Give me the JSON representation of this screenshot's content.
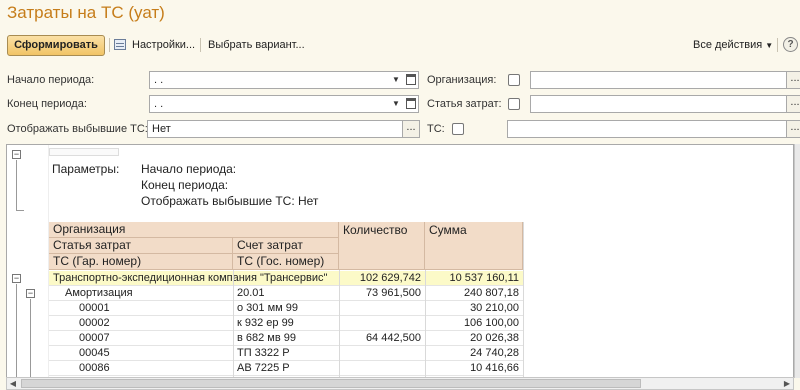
{
  "window": {
    "title": "Затраты на ТС (уат)"
  },
  "toolbar": {
    "generate_label": "Сформировать",
    "settings_label": "Настройки...",
    "choose_variant_label": "Выбрать вариант...",
    "all_actions_label": "Все действия",
    "help_label": "?"
  },
  "filters": {
    "period_start": {
      "label": "Начало периода:",
      "value": " .  ."
    },
    "period_end": {
      "label": "Конец периода:",
      "value": " .  ."
    },
    "show_retired": {
      "label": "Отображать выбывшие ТС:",
      "value": "Нет"
    },
    "organization": {
      "label": "Организация:",
      "checked": false,
      "value": ""
    },
    "cost_item": {
      "label": "Статья затрат:",
      "checked": false,
      "value": ""
    },
    "vehicle": {
      "label": "ТС:",
      "checked": false,
      "value": ""
    }
  },
  "report": {
    "params_label": "Параметры:",
    "params": [
      "Начало периода:",
      "Конец периода:",
      "Отображать выбывшие ТС: Нет"
    ],
    "headers": {
      "organization": "Организация",
      "cost_item": "Статья затрат",
      "account": "Счет затрат",
      "vehicle_garage": "ТС (Гар. номер)",
      "vehicle_state": "ТС (Гос. номер)",
      "quantity": "Количество",
      "sum": "Сумма"
    },
    "rows": [
      {
        "level": 0,
        "name": "Транспортно-экспедиционная компания \"Трансервис\"",
        "col2": "",
        "qty": "102 629,742",
        "sum": "10 537 160,11"
      },
      {
        "level": 1,
        "name": "Амортизация",
        "col2": "20.01",
        "qty": "73 961,500",
        "sum": "240 807,18"
      },
      {
        "level": 2,
        "name": "00001",
        "col2": "о 301 мм 99",
        "qty": "",
        "sum": "30 210,00"
      },
      {
        "level": 2,
        "name": "00002",
        "col2": "к 932 ер 99",
        "qty": "",
        "sum": "106 100,00"
      },
      {
        "level": 2,
        "name": "00007",
        "col2": "в 682 мв 99",
        "qty": "64 442,500",
        "sum": "20 026,38"
      },
      {
        "level": 2,
        "name": "00045",
        "col2": "ТП 3322 Р",
        "qty": "",
        "sum": "24 740,28"
      },
      {
        "level": 2,
        "name": "00086",
        "col2": "АВ 7225 Р",
        "qty": "",
        "sum": "10 416,66"
      }
    ]
  },
  "colors": {
    "title": "#c67d1a",
    "header_bg": "#f2dcc8",
    "org_row_bg": "#fcfac8",
    "button_bg": "#f1c466"
  }
}
